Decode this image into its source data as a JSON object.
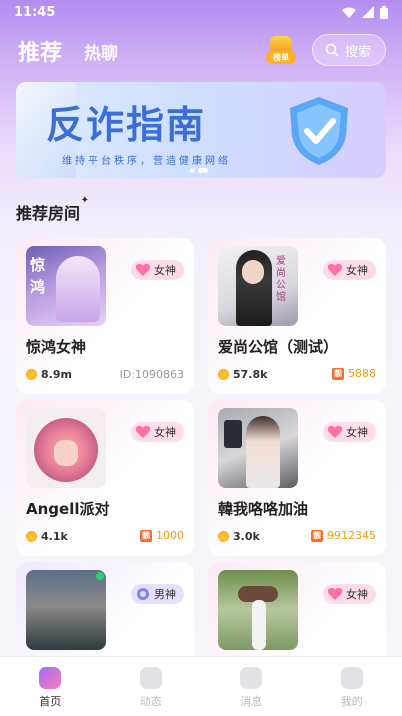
{
  "status": {
    "time": "11:45"
  },
  "header": {
    "tab_active": "推荐",
    "tab_other": "热聊",
    "rank_label": "榜单",
    "search_placeholder": "搜索"
  },
  "banner": {
    "title": "反诈指南",
    "subtitle": "维持平台秩序，营造健康网络",
    "page_count": 2,
    "current_page": 1
  },
  "section": {
    "title": "推荐房间"
  },
  "rooms": [
    {
      "name": "惊鸿女神",
      "tag": "女神",
      "hot": "8.9m",
      "id_text": "ID:1090863",
      "pretty_id": "",
      "thumb_text": "惊\n鸿",
      "theme": "pink"
    },
    {
      "name": "爱尚公馆（测试）",
      "tag": "女神",
      "hot": "57.8k",
      "id_text": "",
      "pretty_id": "5888",
      "thumb_text": "爱尚公馆",
      "theme": "pink"
    },
    {
      "name": "Angell派对",
      "tag": "女神",
      "hot": "4.1k",
      "id_text": "",
      "pretty_id": "1000",
      "thumb_text": "",
      "theme": "pink"
    },
    {
      "name": "韓我咯咯加油",
      "tag": "女神",
      "hot": "3.0k",
      "id_text": "",
      "pretty_id": "9912345",
      "thumb_text": "",
      "theme": "pink"
    },
    {
      "name": "",
      "tag": "男神",
      "hot": "",
      "id_text": "",
      "pretty_id": "",
      "thumb_text": "",
      "theme": "blue"
    },
    {
      "name": "",
      "tag": "女神",
      "hot": "",
      "id_text": "",
      "pretty_id": "",
      "thumb_text": "",
      "theme": "pink"
    }
  ],
  "pretty_badge": "靓",
  "nav": [
    {
      "label": "首页",
      "icon": "home-icon",
      "active": true
    },
    {
      "label": "动态",
      "icon": "feed-icon",
      "active": false
    },
    {
      "label": "消息",
      "icon": "message-icon",
      "active": false
    },
    {
      "label": "我的",
      "icon": "profile-icon",
      "active": false
    }
  ],
  "colors": {
    "accent": "#3b6fd8",
    "gold": "#f29a13",
    "tag_pink": "#ffdcea",
    "tag_blue": "#e6e0ff"
  }
}
